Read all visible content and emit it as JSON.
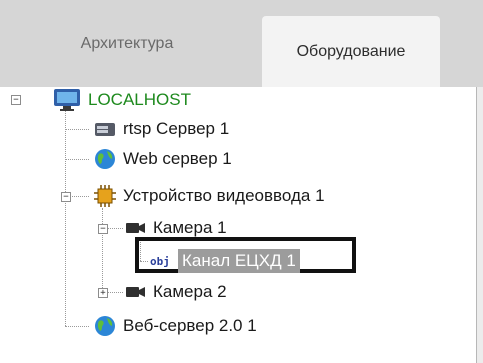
{
  "tabs": {
    "architecture": "Архитектура",
    "equipment": "Оборудование"
  },
  "tree": {
    "root": "LOCALHOST",
    "rtsp": "rtsp Сервер 1",
    "web": "Web сервер 1",
    "device": "Устройство видеоввода 1",
    "camera1": "Камера 1",
    "channel": "Канал ЕЦХД 1",
    "camera2": "Камера 2",
    "web2": "Веб-сервер 2.0 1",
    "obj_icon": "obj",
    "expand_minus": "−",
    "expand_plus": "+"
  },
  "colors": {
    "root_label": "#1e8a1e",
    "selection_bg": "#9c9c9c",
    "active_tab": "#f3f3f3",
    "tab_bar": "#d6d6d6"
  }
}
